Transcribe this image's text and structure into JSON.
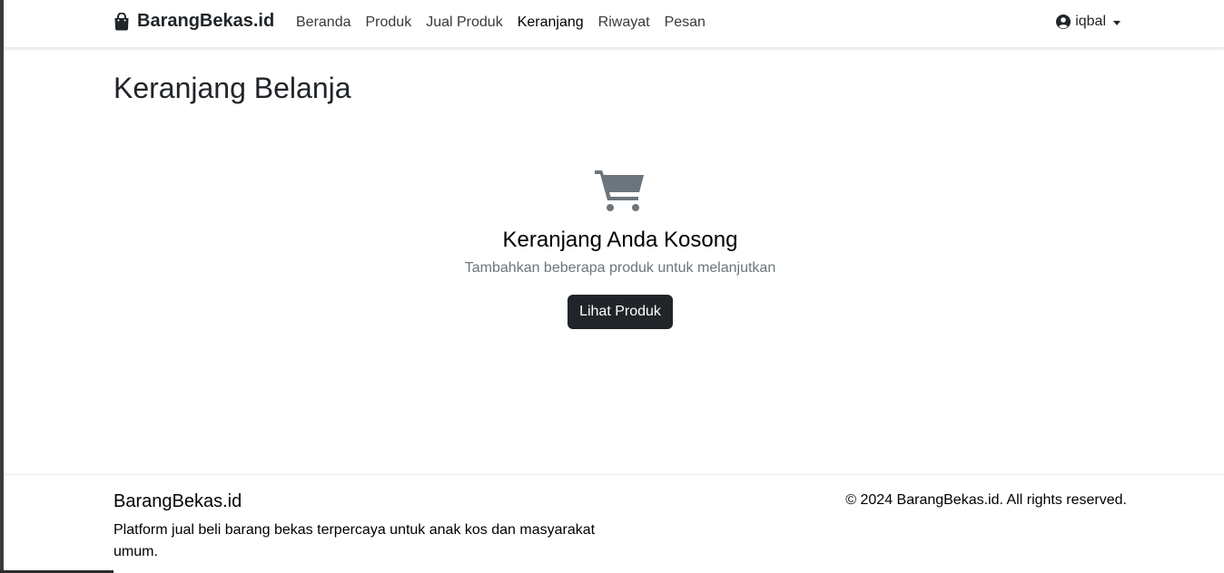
{
  "navbar": {
    "brand": "BarangBekas.id",
    "brand_icon": "shopping-bag-icon",
    "links": [
      {
        "label": "Beranda"
      },
      {
        "label": "Produk"
      },
      {
        "label": "Jual Produk"
      },
      {
        "label": "Keranjang",
        "active": true
      },
      {
        "label": "Riwayat"
      },
      {
        "label": "Pesan"
      }
    ],
    "user": {
      "name": "iqbal",
      "icon": "user-circle-icon"
    }
  },
  "main": {
    "title": "Keranjang Belanja",
    "empty_state": {
      "icon": "cart-icon",
      "title": "Keranjang Anda Kosong",
      "subtitle": "Tambahkan beberapa produk untuk melanjutkan",
      "button_label": "Lihat Produk"
    }
  },
  "footer": {
    "brand": "BarangBekas.id",
    "description": "Platform jual beli barang bekas terpercaya untuk anak kos dan masyarakat umum.",
    "copyright": "© 2024 BarangBekas.id. All rights reserved."
  },
  "colors": {
    "primary_text": "#212529",
    "muted_text": "#6c757d",
    "button_bg": "#212529",
    "icon_gray": "#6c757d"
  }
}
